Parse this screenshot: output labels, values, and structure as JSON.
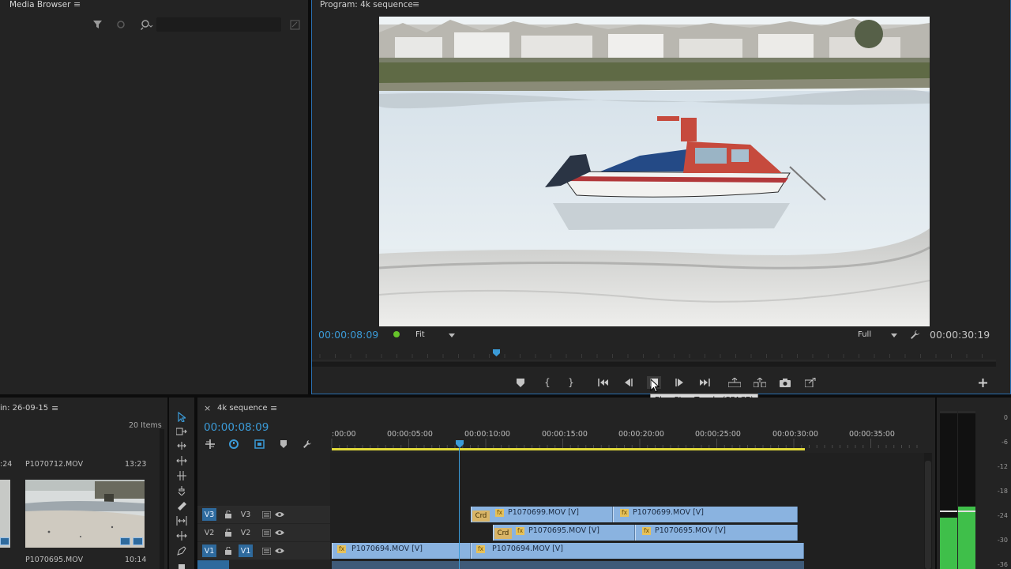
{
  "media_browser": {
    "tab_label": "Media Browser",
    "menu_icon": "hamburger-icon",
    "filter_icon": "filter-icon",
    "view_icon": "eye-icon",
    "search_icon": "search-icon",
    "new_bin_icon": "new-item-icon"
  },
  "program_monitor": {
    "tab_label": "Program: 4k sequence",
    "current_timecode": "00:00:08:09",
    "fit_label": "Fit",
    "quality_label": "Full",
    "duration_timecode": "00:00:30:19",
    "tooltip": "Play-Stop Toggle (SPACE)",
    "playhead_fraction": 0.29,
    "controls": [
      "marker-icon",
      "mark-in-icon",
      "mark-out-icon",
      "go-to-in-icon",
      "step-back-icon",
      "play-stop-icon",
      "step-forward-icon",
      "go-to-out-icon",
      "lift-icon",
      "extract-icon",
      "export-frame-icon",
      "insert-icon",
      "add-icon"
    ]
  },
  "bin": {
    "title": "in: 26-09-15",
    "item_count": "20 Items",
    "items": [
      {
        "name": "P1070712.MOV",
        "duration": "13:23",
        "left_partial": ":24"
      },
      {
        "name": "P1070695.MOV",
        "duration": "10:14"
      }
    ]
  },
  "timeline": {
    "tab_label": "4k sequence",
    "close_label": "×",
    "current_timecode": "00:00:08:09",
    "ruler": [
      ":00:00",
      "00:00:05:00",
      "00:00:10:00",
      "00:00:15:00",
      "00:00:20:00",
      "00:00:25:00",
      "00:00:30:00",
      "00:00:35:00"
    ],
    "tracks": [
      {
        "id": "V3",
        "target": "V3"
      },
      {
        "id": "V2",
        "target": "V2"
      },
      {
        "id": "V1",
        "target": "V1"
      }
    ],
    "clips": {
      "v3_a": "P1070699.MOV [V]",
      "v3_b": "P1070699.MOV [V]",
      "v2_a": "P1070695.MOV [V]",
      "v2_b": "P1070695.MOV [V]",
      "v1_a": "P1070694.MOV [V]",
      "v1_b": "P1070694.MOV [V]",
      "crd": "Crd",
      "fx": "fx"
    }
  },
  "meters": {
    "scale": [
      "0",
      "-6",
      "-12",
      "-18",
      "-24",
      "-30",
      "-36"
    ],
    "left_level": 0.33,
    "right_level": 0.4
  }
}
